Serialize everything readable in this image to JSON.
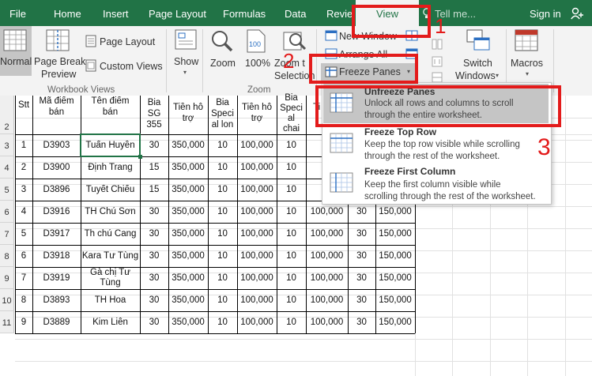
{
  "tabs": [
    "File",
    "Home",
    "Insert",
    "Page Layout",
    "Formulas",
    "Data",
    "Review",
    "View"
  ],
  "active_tab": "View",
  "search": {
    "placeholder": "Tell me..."
  },
  "sign_in": "Sign in",
  "ribbon": {
    "normal": "Normal",
    "page_break_preview_1": "Page Break",
    "page_break_preview_2": "Preview",
    "page_layout": "Page Layout",
    "custom_views": "Custom Views",
    "workbook_views_label": "Workbook Views",
    "show": "Show",
    "zoom": "Zoom",
    "zoom_100": "100%",
    "zoom_to_selection_1": "Zoom t",
    "zoom_to_selection_2": "Selection",
    "zoom_group_label": "Zoom",
    "new_window": "New Window",
    "arrange_all": "Arrange All",
    "freeze_panes": "Freeze Panes",
    "switch_windows_1": "Switch",
    "switch_windows_2": "Windows",
    "macros": "Macros"
  },
  "freeze_menu": [
    {
      "title": "Unfreeze Panes",
      "desc1": "Unlock all rows and columns to scroll",
      "desc2": "through the entire worksheet."
    },
    {
      "title": "Freeze Top Row",
      "desc1": "Keep the top row visible while scrolling",
      "desc2": "through the rest of the worksheet."
    },
    {
      "title": "Freeze First Column",
      "desc1": "Keep the first column visible while",
      "desc2": "scrolling through the rest of the worksheet."
    }
  ],
  "annotations": [
    "1",
    "2",
    "3"
  ],
  "headers": {
    "stt": "Stt",
    "ma_1": "Mã điểm",
    "ma_2": "bán",
    "ten_1": "Tên điểm",
    "ten_2": "bán",
    "bia_1": "Bia",
    "bia_2": "SG",
    "bia_3": "355",
    "tien1_1": "Tiền hỗ",
    "tien1_2": "trợ",
    "special_1": "Bia",
    "special_2": "Speci",
    "special_3": "al lon",
    "tien2_1": "Tiền hỗ",
    "tien2_2": "trợ",
    "chai_1": "Bia",
    "chai_2": "Speci",
    "chai_3": "al",
    "chai_4": "chai",
    "ti_1": "Ti"
  },
  "row_numbers": [
    "2",
    "3",
    "4",
    "5",
    "6",
    "7",
    "8",
    "9",
    "10",
    "11"
  ],
  "rows": [
    {
      "stt": "1",
      "ma": "D3903",
      "ten": "Tuấn Huyền",
      "bia": "30",
      "tien1": "350,000",
      "sp": "10",
      "tien2": "100,000",
      "chai": "10",
      "ex1": "",
      "ex2": "",
      "ex3": ""
    },
    {
      "stt": "2",
      "ma": "D3900",
      "ten": "Định Trang",
      "bia": "15",
      "tien1": "350,000",
      "sp": "10",
      "tien2": "100,000",
      "chai": "10",
      "ex1": "",
      "ex2": "",
      "ex3": ""
    },
    {
      "stt": "3",
      "ma": "D3896",
      "ten": "Tuyết Chiếu",
      "bia": "15",
      "tien1": "350,000",
      "sp": "10",
      "tien2": "100,000",
      "chai": "10",
      "ex1": "",
      "ex2": "",
      "ex3": ""
    },
    {
      "stt": "4",
      "ma": "D3916",
      "ten": "TH Chú Sơn",
      "bia": "30",
      "tien1": "350,000",
      "sp": "10",
      "tien2": "100,000",
      "chai": "10",
      "ex1": "100,000",
      "ex2": "30",
      "ex3": "150,000"
    },
    {
      "stt": "5",
      "ma": "D3917",
      "ten": "Th chú Cang",
      "bia": "30",
      "tien1": "350,000",
      "sp": "10",
      "tien2": "100,000",
      "chai": "10",
      "ex1": "100,000",
      "ex2": "30",
      "ex3": "150,000"
    },
    {
      "stt": "6",
      "ma": "D3918",
      "ten": "Kara Tư Tùng",
      "bia": "30",
      "tien1": "350,000",
      "sp": "10",
      "tien2": "100,000",
      "chai": "10",
      "ex1": "100,000",
      "ex2": "30",
      "ex3": "150,000"
    },
    {
      "stt": "7",
      "ma": "D3919",
      "ten": "Gà chị Tư Tùng",
      "bia": "30",
      "tien1": "350,000",
      "sp": "10",
      "tien2": "100,000",
      "chai": "10",
      "ex1": "100,000",
      "ex2": "30",
      "ex3": "150,000"
    },
    {
      "stt": "8",
      "ma": "D3893",
      "ten": "TH Hoa",
      "bia": "30",
      "tien1": "350,000",
      "sp": "10",
      "tien2": "100,000",
      "chai": "10",
      "ex1": "100,000",
      "ex2": "30",
      "ex3": "150,000"
    },
    {
      "stt": "9",
      "ma": "D3889",
      "ten": "Kim Liên",
      "bia": "30",
      "tien1": "350,000",
      "sp": "10",
      "tien2": "100,000",
      "chai": "10",
      "ex1": "100,000",
      "ex2": "30",
      "ex3": "150,000"
    }
  ]
}
